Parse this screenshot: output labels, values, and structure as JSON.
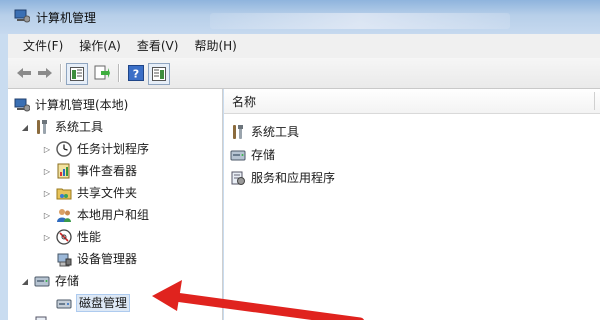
{
  "window": {
    "title": "计算机管理"
  },
  "menu": {
    "file": "文件(F)",
    "action": "操作(A)",
    "view": "查看(V)",
    "help": "帮助(H)"
  },
  "tree": {
    "root": "计算机管理(本地)",
    "system_tools": "系统工具",
    "task_scheduler": "任务计划程序",
    "event_viewer": "事件查看器",
    "shared_folders": "共享文件夹",
    "local_users": "本地用户和组",
    "performance": "性能",
    "device_manager": "设备管理器",
    "storage": "存储",
    "disk_management": "磁盘管理"
  },
  "list": {
    "column_name": "名称",
    "items": [
      "系统工具",
      "存储",
      "服务和应用程序"
    ]
  },
  "colors": {
    "arrow": "#e0231e",
    "accent": "#2b6cc4"
  }
}
